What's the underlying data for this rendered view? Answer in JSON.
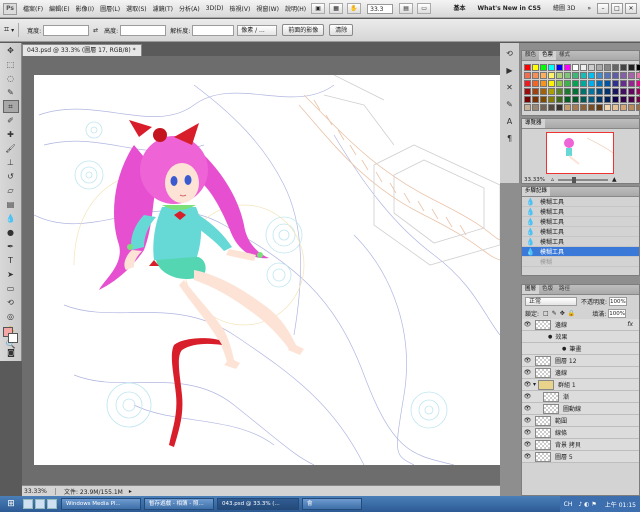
{
  "app": {
    "logo": "Ps"
  },
  "menubar": {
    "items": [
      "檔案(F)",
      "編輯(E)",
      "影像(I)",
      "圖層(L)",
      "選取(S)",
      "濾鏡(T)",
      "分析(A)",
      "3D(D)",
      "檢視(V)",
      "視窗(W)",
      "說明(H)"
    ],
    "zoom": "33.3",
    "workspaces": [
      "基本",
      "What's New in CS5",
      "繪圖 3D"
    ],
    "window_controls": [
      "–",
      "□",
      "✕"
    ]
  },
  "options": {
    "width_label": "寬度:",
    "height_label": "高度:",
    "res_label": "解析度:",
    "units": "像素 / ...",
    "front_button": "前面的影像",
    "clear_button": "清除",
    "swap_icon": "⇄"
  },
  "document": {
    "tab": "043.psd @ 33.3% (圖層 17, RGB/8) *"
  },
  "status": {
    "zoom": "33.33%",
    "doc": "文件: 23.9M/155.1M"
  },
  "panels": {
    "color_tabs": [
      "顏色",
      "色票",
      "樣式"
    ],
    "nav_tabs": [
      "導覽器"
    ],
    "nav_zoom": "33.33%",
    "history_tabs": [
      "步驟記錄"
    ],
    "history_items": [
      "模糊工具",
      "模糊工具",
      "模糊工具",
      "模糊工具",
      "模糊工具",
      "模糊工具"
    ],
    "history_active": "模糊工具",
    "history_faded": "模糊",
    "layer_tabs": [
      "圖層",
      "色版",
      "路徑"
    ],
    "blend_mode": "正常",
    "opacity_label": "不透明度:",
    "opacity": "100%",
    "lock_label": "鎖定:",
    "fill_label": "填滿:",
    "fill": "100%",
    "layers": [
      {
        "name": "邊線",
        "fx": "fx"
      },
      {
        "name": "效果",
        "sub": true
      },
      {
        "name": "筆畫",
        "sub": true,
        "deep": true
      },
      {
        "name": "圖層 12"
      },
      {
        "name": "邊線"
      },
      {
        "name": "群組 1",
        "folder": true
      },
      {
        "name": "漸",
        "indent": true
      },
      {
        "name": "圖動線",
        "indent": true
      },
      {
        "name": "範圍"
      },
      {
        "name": "線條"
      },
      {
        "name": "背景 拷貝"
      },
      {
        "name": "圖層 5"
      }
    ]
  },
  "taskbar": {
    "tasks": [
      "Windows Media Pl...",
      "暫存遊戲 - 相簿 - 照...",
      "043.psd @ 33.3% (...",
      "會"
    ],
    "tray_lang": "CH",
    "tray_time": "上午 01:15"
  },
  "colors": {
    "fg": "#f3a7a7",
    "bg": "#ffffff",
    "accent": "#3b79d9"
  }
}
